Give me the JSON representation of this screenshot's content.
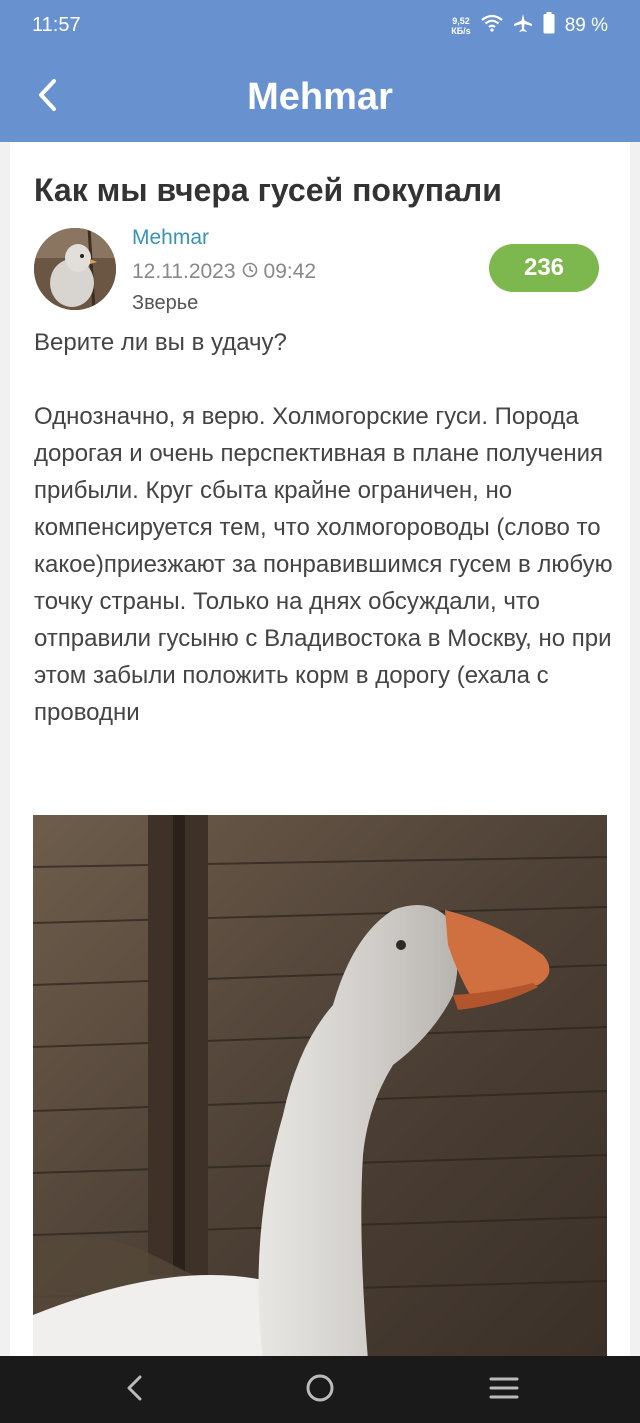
{
  "status_bar": {
    "time": "11:57",
    "net_speed_value": "9,52",
    "net_speed_unit": "КБ/s",
    "battery": "89 %"
  },
  "app_bar": {
    "title": "Mehmar",
    "back_icon": "chevron-left-icon"
  },
  "post": {
    "title": "Как мы вчера гусей покупали",
    "author": "Mehmar",
    "date": "12.11.2023",
    "time": "09:42",
    "category": "Зверье",
    "count": "236",
    "paragraphs": [
      "Верите ли вы в удачу?",
      "Однозначно, я верю. Холмогорские гуси. Порода дорогая и очень перспективная в плане получения прибыли. Круг сбыта крайне ограничен, но компенсируется тем, что холмогороводы (слово то какое)приезжают за понравившимся гусем в любую точку страны. Только на днях обсуждали, что отправили гусыню с Владивостока в Москву, но при этом забыли положить корм в дорогу (ехала с проводни"
    ]
  },
  "colors": {
    "app_bar": "#6892cf",
    "author": "#3795b3",
    "badge": "#7db84e",
    "nav_bar": "#1a1a1a"
  },
  "nav": {
    "back_icon": "back-triangle-icon",
    "home_icon": "home-circle-icon",
    "menu_icon": "menu-lines-icon"
  }
}
